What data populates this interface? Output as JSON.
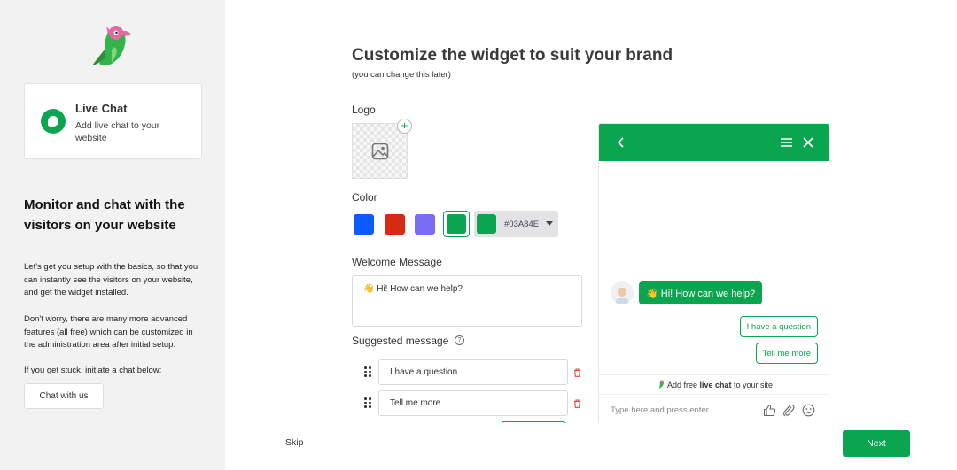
{
  "sidebar": {
    "product": {
      "title": "Live Chat",
      "desc": "Add live chat to your website"
    },
    "heading": "Monitor and chat with the visitors on your website",
    "para1": "Let's get you setup with the basics, so that you can instantly see the visitors on your website, and get the widget installed.",
    "para2": "Don't worry, there are many more advanced features (all free) which can be customized in the administration area after initial setup.",
    "para3": "If you get stuck, initiate a chat below:",
    "chat_button": "Chat with us"
  },
  "main": {
    "title": "Customize the widget to suit your brand",
    "subtitle": "(you can change this later)",
    "logo_label": "Logo",
    "add_logo": "+",
    "color_label": "Color",
    "colors": {
      "blue": "#0B5CFF",
      "red": "#D42B12",
      "purple": "#7B6CF6",
      "green": "#03A84E"
    },
    "color_hex": "#03A84E",
    "welcome_label": "Welcome Message",
    "welcome_value": "👋 Hi! How can we help?",
    "suggested_label": "Suggested message",
    "help": "?",
    "suggestions": [
      "I have a question",
      "Tell me more"
    ]
  },
  "widget": {
    "greeting": "👋 Hi! How can we help?",
    "quick_replies": [
      "I have a question",
      "Tell me more"
    ],
    "branding_prefix": "Add free ",
    "branding_bold": "live chat",
    "branding_suffix": " to your site",
    "input_placeholder": "Type here and press enter.."
  },
  "footer": {
    "skip": "Skip",
    "next": "Next"
  },
  "icons": [
    "parrot-logo-icon",
    "chat-bubble-icon",
    "image-icon",
    "drag-handle-icon",
    "trash-icon",
    "help-icon",
    "back-arrow-icon",
    "menu-icon",
    "close-icon",
    "thumbs-up-icon",
    "attachment-icon",
    "emoji-icon",
    "caret-down-icon"
  ]
}
